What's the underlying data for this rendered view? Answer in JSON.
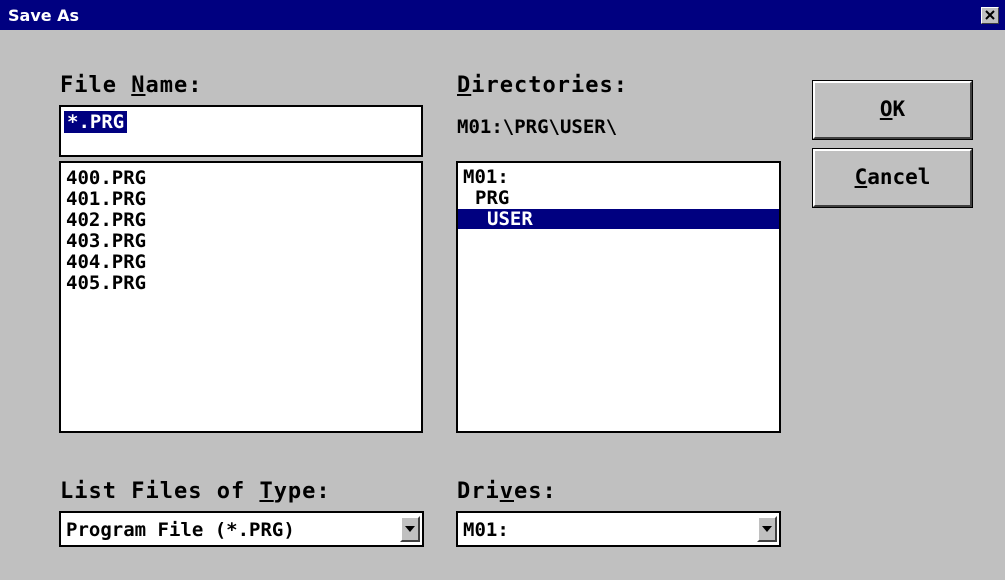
{
  "window": {
    "title": "Save As",
    "close_label": "Close"
  },
  "file_name": {
    "label_pre": "File ",
    "label_key": "N",
    "label_post": "ame:",
    "value": "*.PRG"
  },
  "file_list": {
    "items": [
      "400.PRG",
      "401.PRG",
      "402.PRG",
      "403.PRG",
      "404.PRG",
      "405.PRG"
    ]
  },
  "directories": {
    "label_key": "D",
    "label_post": "irectories:",
    "current_path": "M01:\\PRG\\USER\\",
    "items": [
      "M01:",
      "PRG",
      "USER"
    ],
    "selected": "USER"
  },
  "buttons": {
    "ok_key": "O",
    "ok_post": "K",
    "cancel_key": "C",
    "cancel_post": "ancel"
  },
  "file_type": {
    "label_pre": "List Files of ",
    "label_key": "T",
    "label_post": "ype:",
    "selected": "Program File (*.PRG)"
  },
  "drives": {
    "label_pre": "Dri",
    "label_key": "v",
    "label_post": "es:",
    "selected": "M01:"
  },
  "colors": {
    "face": "#c0c0c0",
    "titlebar": "#000080",
    "selection": "#000080"
  }
}
